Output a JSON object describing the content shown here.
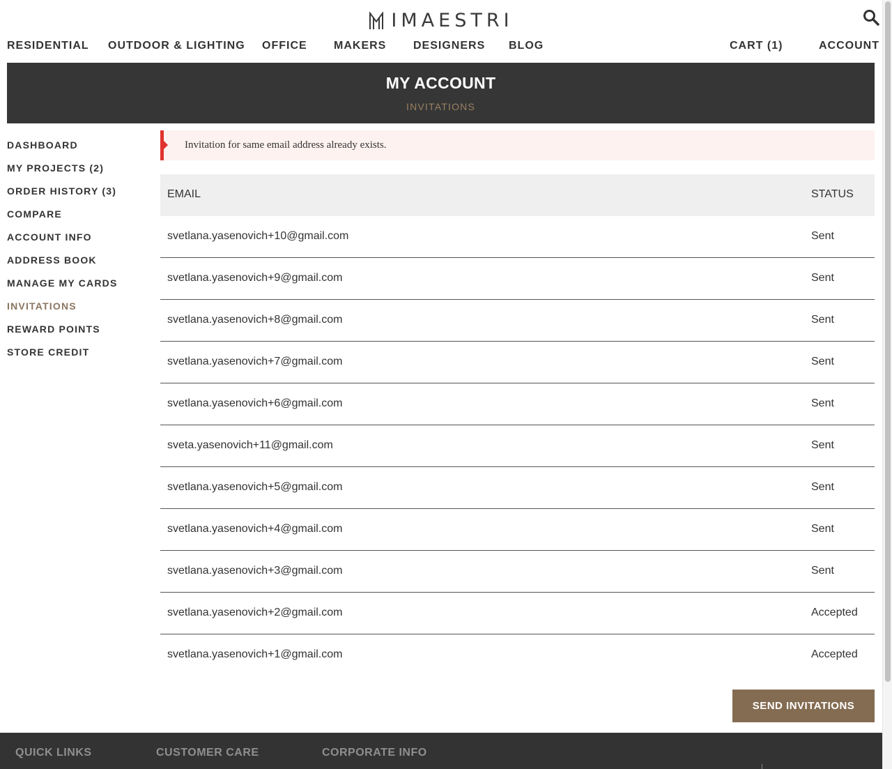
{
  "brand": {
    "name": "IMAESTRI",
    "logo_icon": "imaestri-monogram"
  },
  "header": {
    "search_icon": "search-icon",
    "nav": [
      {
        "label": "RESIDENTIAL"
      },
      {
        "label": "OUTDOOR & LIGHTING"
      },
      {
        "label": "OFFICE"
      },
      {
        "label": "MAKERS"
      },
      {
        "label": "DESIGNERS"
      },
      {
        "label": "BLOG"
      }
    ],
    "cart_label": "CART (1)",
    "account_label": "ACCOUNT"
  },
  "banner": {
    "title": "MY ACCOUNT",
    "subtitle": "INVITATIONS"
  },
  "sidebar": {
    "items": [
      {
        "label": "DASHBOARD"
      },
      {
        "label": "MY PROJECTS (2)"
      },
      {
        "label": "ORDER HISTORY (3)"
      },
      {
        "label": "COMPARE"
      },
      {
        "label": "ACCOUNT INFO"
      },
      {
        "label": "ADDRESS BOOK"
      },
      {
        "label": "MANAGE MY CARDS"
      },
      {
        "label": "INVITATIONS",
        "active": true
      },
      {
        "label": "REWARD POINTS"
      },
      {
        "label": "STORE CREDIT"
      }
    ]
  },
  "alert": {
    "message": "Invitation for same email address already exists.",
    "color": "#e1322e"
  },
  "invitations": {
    "headers": {
      "email": "EMAIL",
      "status": "STATUS"
    },
    "rows": [
      {
        "email": "svetlana.yasenovich+10@gmail.com",
        "status": "Sent"
      },
      {
        "email": "svetlana.yasenovich+9@gmail.com",
        "status": "Sent"
      },
      {
        "email": "svetlana.yasenovich+8@gmail.com",
        "status": "Sent"
      },
      {
        "email": "svetlana.yasenovich+7@gmail.com",
        "status": "Sent"
      },
      {
        "email": "svetlana.yasenovich+6@gmail.com",
        "status": "Sent"
      },
      {
        "email": "sveta.yasenovich+11@gmail.com",
        "status": "Sent"
      },
      {
        "email": "svetlana.yasenovich+5@gmail.com",
        "status": "Sent"
      },
      {
        "email": "svetlana.yasenovich+4@gmail.com",
        "status": "Sent"
      },
      {
        "email": "svetlana.yasenovich+3@gmail.com",
        "status": "Sent"
      },
      {
        "email": "svetlana.yasenovich+2@gmail.com",
        "status": "Accepted"
      },
      {
        "email": "svetlana.yasenovich+1@gmail.com",
        "status": "Accepted"
      }
    ]
  },
  "actions": {
    "send_label": "SEND INVITATIONS",
    "accent": "#846c52"
  },
  "footer": {
    "headings": [
      {
        "label": "QUICK LINKS"
      },
      {
        "label": "CUSTOMER CARE"
      },
      {
        "label": "CORPORATE INFO"
      }
    ]
  }
}
